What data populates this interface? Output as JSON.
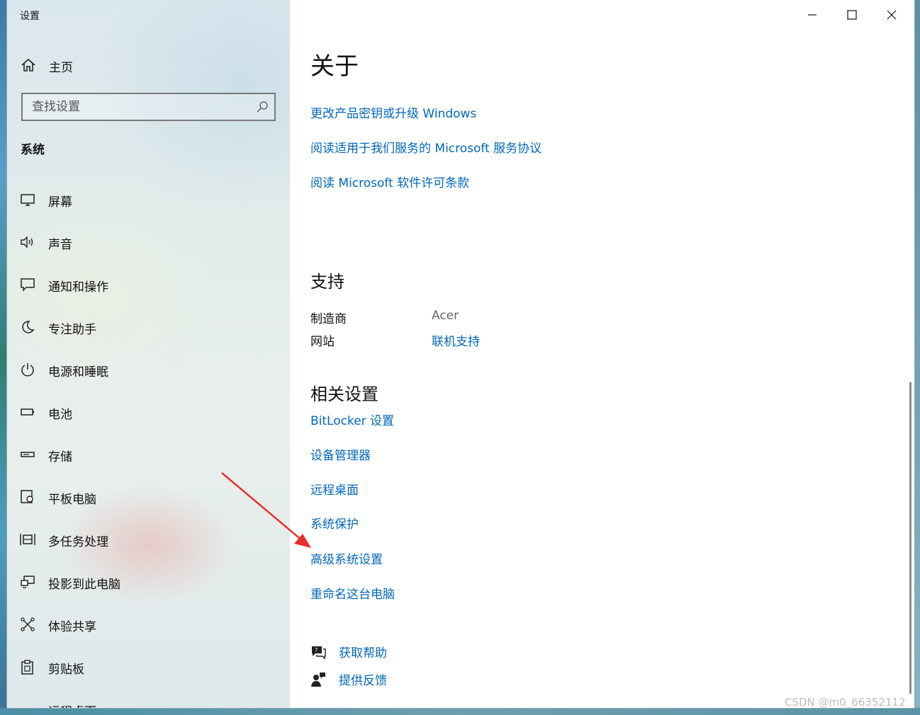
{
  "window": {
    "title": "设置"
  },
  "sidebar": {
    "home_label": "主页",
    "search_placeholder": "查找设置",
    "section_title": "系统",
    "items": [
      {
        "label": "屏幕",
        "icon": "monitor-icon"
      },
      {
        "label": "声音",
        "icon": "speaker-icon"
      },
      {
        "label": "通知和操作",
        "icon": "message-icon"
      },
      {
        "label": "专注助手",
        "icon": "moon-icon"
      },
      {
        "label": "电源和睡眠",
        "icon": "power-icon"
      },
      {
        "label": "电池",
        "icon": "battery-icon"
      },
      {
        "label": "存储",
        "icon": "storage-icon"
      },
      {
        "label": "平板电脑",
        "icon": "tablet-icon"
      },
      {
        "label": "多任务处理",
        "icon": "multitask-icon"
      },
      {
        "label": "投影到此电脑",
        "icon": "project-icon"
      },
      {
        "label": "体验共享",
        "icon": "share-icon"
      },
      {
        "label": "剪贴板",
        "icon": "clipboard-icon"
      },
      {
        "label": "远程桌面",
        "icon": "remote-icon"
      }
    ]
  },
  "main": {
    "title": "关于",
    "top_links": [
      "更改产品密钥或升级 Windows",
      "阅读适用于我们服务的 Microsoft 服务协议",
      "阅读 Microsoft 软件许可条款"
    ],
    "support": {
      "heading": "支持",
      "manufacturer_label": "制造商",
      "manufacturer_value": "Acer",
      "website_label": "网站",
      "website_link": "联机支持"
    },
    "related": {
      "heading": "相关设置",
      "links": [
        "BitLocker 设置",
        "设备管理器",
        "远程桌面",
        "系统保护",
        "高级系统设置",
        "重命名这台电脑"
      ]
    },
    "help": {
      "get_help": "获取帮助",
      "feedback": "提供反馈"
    }
  },
  "annotation": {
    "arrow_color": "#e8302a"
  },
  "watermark": "CSDN @m0_66352112",
  "colors": {
    "link": "#0067b8",
    "text": "#111111"
  }
}
